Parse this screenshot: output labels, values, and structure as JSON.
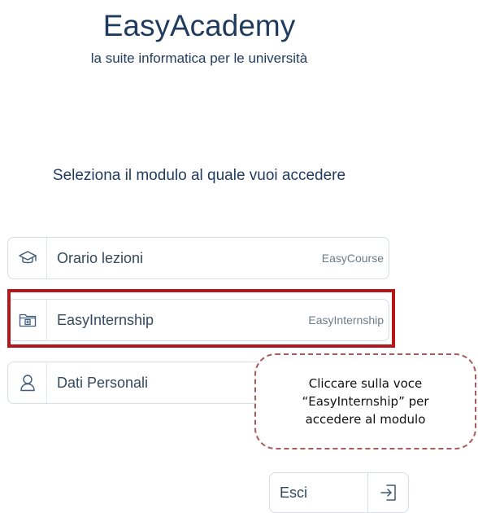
{
  "header": {
    "title": "EasyAcademy",
    "subtitle": "la suite informatica per le università"
  },
  "prompt": "Seleziona il modulo al quale vuoi accedere",
  "modules": [
    {
      "label": "Orario lezioni",
      "tag": "EasyCourse",
      "icon": "graduation-cap-icon"
    },
    {
      "label": "EasyInternship",
      "tag": "EasyInternship",
      "icon": "folder-plus-icon"
    },
    {
      "label": "Dati Personali",
      "tag": "",
      "icon": "user-icon"
    }
  ],
  "callout": {
    "text": "Cliccare sulla voce “EasyInternship” per accedere al modulo"
  },
  "exit": {
    "label": "Esci",
    "icon": "logout-arrow-icon"
  },
  "colors": {
    "title": "#1f3b5e",
    "highlight": "#b4161b",
    "callout_border": "#a85a5a",
    "icon_stroke": "#3d5a78"
  }
}
